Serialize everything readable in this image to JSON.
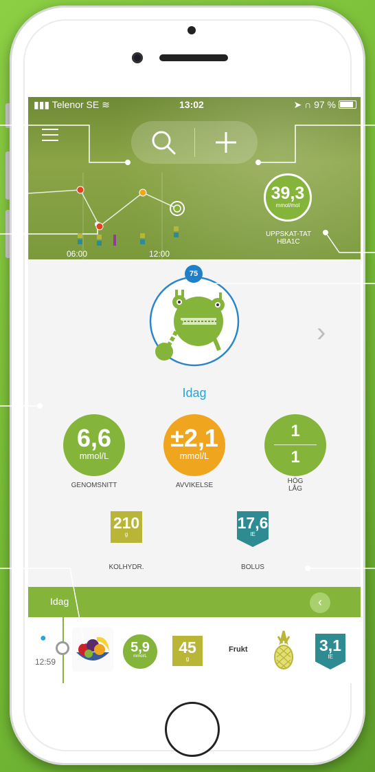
{
  "status_bar": {
    "carrier": "Telenor SE",
    "time": "13:02",
    "battery": "97 %"
  },
  "header": {
    "hba1c_value": "39,3",
    "hba1c_unit": "mmol/mol",
    "hba1c_label": "UPPSKAT-TAT HBA1C",
    "chart_ticks": [
      "06:00",
      "12:00"
    ]
  },
  "mascot": {
    "level": "75"
  },
  "period_label": "Idag",
  "stats": {
    "average": {
      "value": "6,6",
      "unit": "mmol/L",
      "label": "GENOMSNITT"
    },
    "deviation": {
      "value": "±2,1",
      "unit": "mmol/L",
      "label": "AVVIKELSE"
    },
    "high_low": {
      "high": "1",
      "low": "1",
      "label": "HÖG LÅG"
    },
    "carbs": {
      "value": "210",
      "unit": "g",
      "label": "KOLHYDR."
    },
    "bolus": {
      "value": "17,6",
      "unit": "IE",
      "label": "BOLUS"
    }
  },
  "log": {
    "header_label": "Idag",
    "entry": {
      "time": "12:59",
      "glucose_value": "5,9",
      "glucose_unit": "mmol/L",
      "carbs_value": "45",
      "carbs_unit": "g",
      "food_label": "Frukt",
      "insulin_value": "3,1",
      "insulin_unit": "IE"
    }
  },
  "colors": {
    "green": "#84b53a",
    "orange": "#f0a51e",
    "blue": "#2aa3d6",
    "olive": "#b9b637",
    "teal": "#2e8b92"
  }
}
